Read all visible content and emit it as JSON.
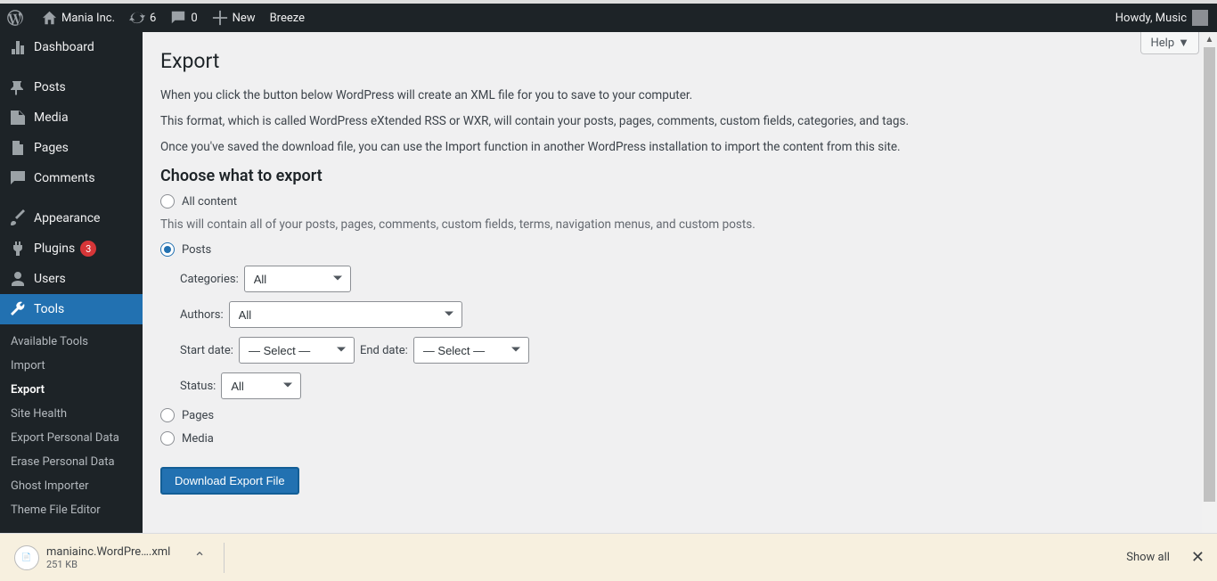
{
  "adminbar": {
    "site_name": "Mania Inc.",
    "updates_count": "6",
    "comments_count": "0",
    "new_label": "New",
    "extra_items": [
      "Breeze"
    ],
    "greeting": "Howdy, Music"
  },
  "sidebar": {
    "items": [
      {
        "icon": "dashboard",
        "label": "Dashboard"
      },
      {
        "sep": true
      },
      {
        "icon": "pin",
        "label": "Posts"
      },
      {
        "icon": "media",
        "label": "Media"
      },
      {
        "icon": "page",
        "label": "Pages"
      },
      {
        "icon": "comment",
        "label": "Comments"
      },
      {
        "sep": true
      },
      {
        "icon": "brush",
        "label": "Appearance"
      },
      {
        "icon": "plugin",
        "label": "Plugins",
        "badge": "3"
      },
      {
        "icon": "user",
        "label": "Users"
      },
      {
        "icon": "tool",
        "label": "Tools",
        "current": true
      }
    ],
    "submenu": [
      {
        "label": "Available Tools"
      },
      {
        "label": "Import"
      },
      {
        "label": "Export",
        "current": true
      },
      {
        "label": "Site Health"
      },
      {
        "label": "Export Personal Data"
      },
      {
        "label": "Erase Personal Data"
      },
      {
        "label": "Ghost Importer"
      },
      {
        "label": "Theme File Editor"
      }
    ]
  },
  "main": {
    "help_label": "Help",
    "title": "Export",
    "intro": [
      "When you click the button below WordPress will create an XML file for you to save to your computer.",
      "This format, which is called WordPress eXtended RSS or WXR, will contain your posts, pages, comments, custom fields, categories, and tags.",
      "Once you've saved the download file, you can use the Import function in another WordPress installation to import the content from this site."
    ],
    "section_heading": "Choose what to export",
    "all_content_label": "All content",
    "all_content_desc": "This will contain all of your posts, pages, comments, custom fields, terms, navigation menus, and custom posts.",
    "posts_label": "Posts",
    "filters": {
      "categories_label": "Categories:",
      "categories_value": "All",
      "authors_label": "Authors:",
      "authors_value": "All",
      "start_date_label": "Start date:",
      "start_date_value": "— Select —",
      "end_date_label": "End date:",
      "end_date_value": "— Select —",
      "status_label": "Status:",
      "status_value": "All"
    },
    "pages_label": "Pages",
    "media_label": "Media",
    "download_button": "Download Export File"
  },
  "downloadbar": {
    "filename": "maniainc.WordPre….xml",
    "size": "251 KB",
    "show_all": "Show all"
  }
}
